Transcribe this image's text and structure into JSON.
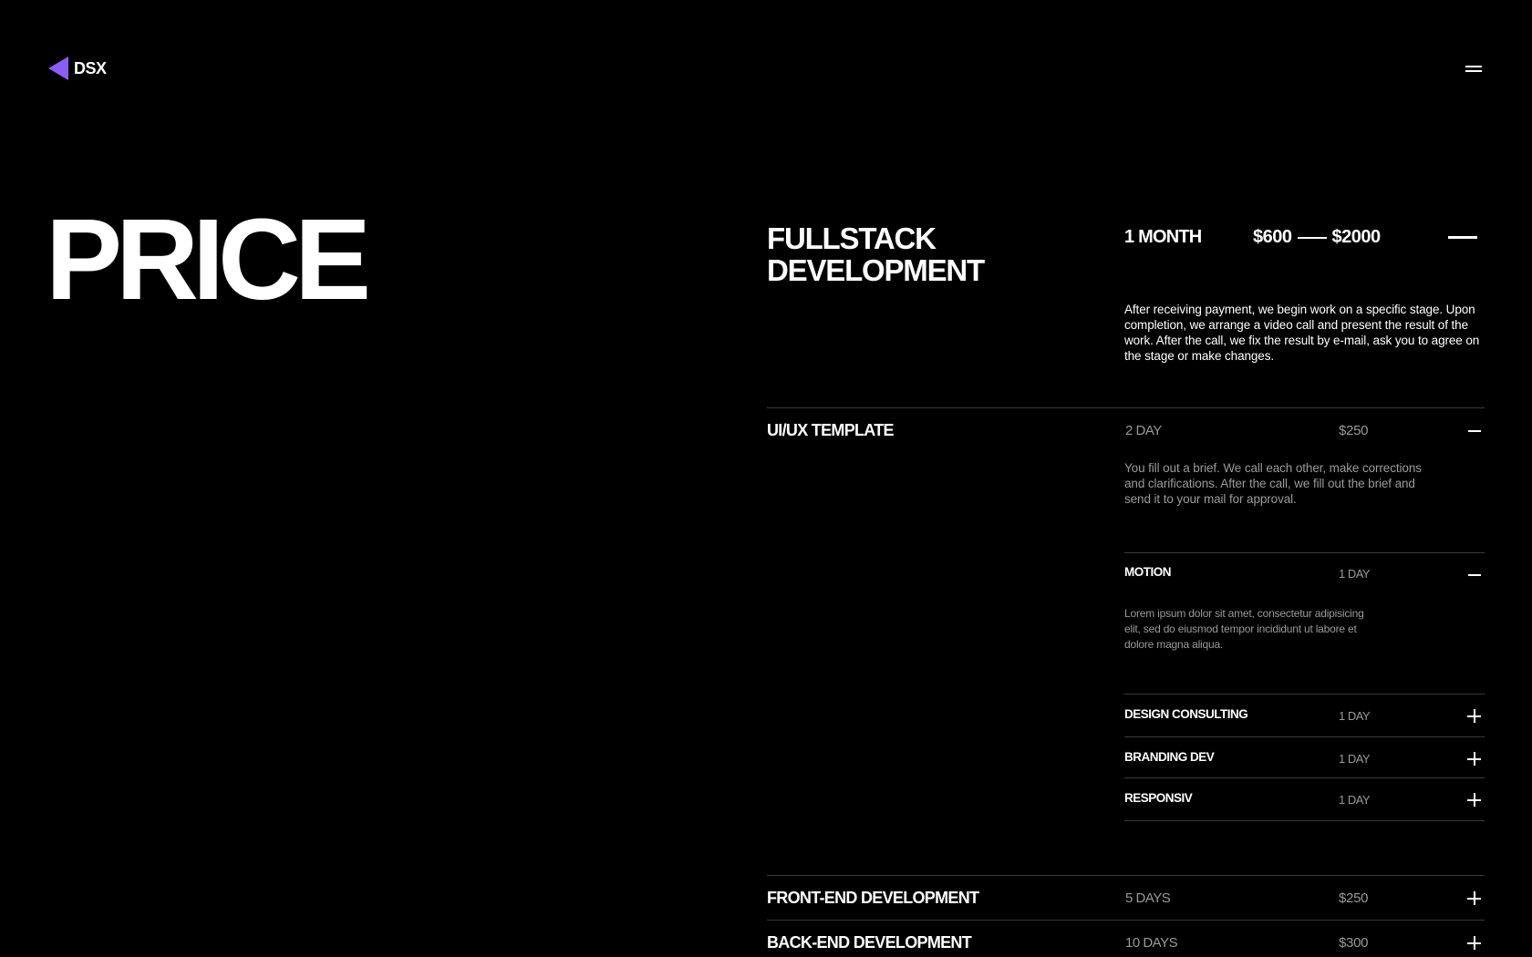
{
  "brand": {
    "name": "DSX",
    "accent": "#8b5cf6"
  },
  "hero": {
    "title": "PRICE"
  },
  "main": {
    "title_line1": "FULLSTACK",
    "title_line2": "DEVELOPMENT",
    "duration": "1 MONTH",
    "price_from": "$600",
    "price_to": "$2000",
    "description": "After receiving payment, we begin work on a specific stage. Upon completion, we arrange a video call and present the result of the work. After the call, we fix the result by e-mail, ask you to agree on the stage or make changes."
  },
  "items": [
    {
      "title": "UI/UX TEMPLATE",
      "duration": "2 DAY",
      "price": "$250",
      "expanded": true,
      "description": "You fill out a brief. We call each other, make corrections and clarifications. After the call, we fill out the brief and send it to your mail for approval.",
      "subitems": [
        {
          "title": "MOTION",
          "duration": "1 DAY",
          "expanded": true,
          "description": "Lorem ipsum dolor sit amet, consectetur adipisicing elit, sed do eiusmod tempor incididunt ut labore et dolore magna aliqua."
        },
        {
          "title": "DESIGN CONSULTING",
          "duration": "1 DAY",
          "expanded": false
        },
        {
          "title": "BRANDING DEV",
          "duration": "1 DAY",
          "expanded": false
        },
        {
          "title": "RESPONSIV",
          "duration": "1 DAY",
          "expanded": false
        }
      ]
    },
    {
      "title": "FRONT-END DEVELOPMENT",
      "duration": "5 DAYS",
      "price": "$250",
      "expanded": false
    },
    {
      "title": "BACK-END DEVELOPMENT",
      "duration": "10 DAYS",
      "price": "$300",
      "expanded": false
    }
  ]
}
